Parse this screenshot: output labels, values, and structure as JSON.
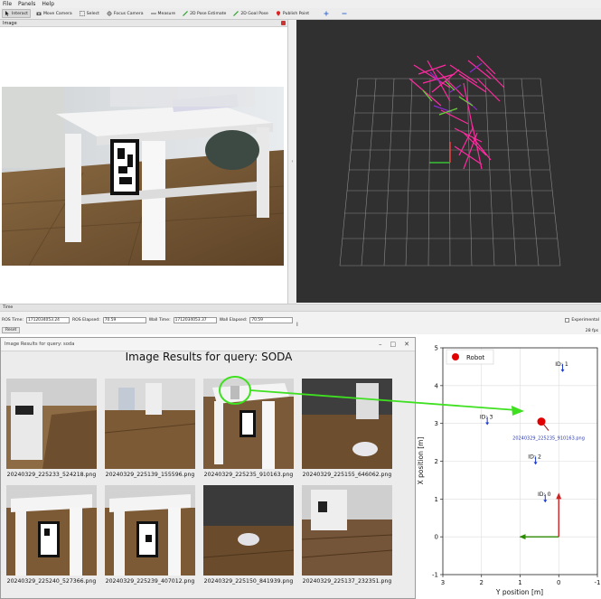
{
  "menu": [
    "File",
    "Panels",
    "Help"
  ],
  "toolbar": {
    "tools": [
      {
        "label": "Interact",
        "icon": "interact-icon",
        "active": true
      },
      {
        "label": "Move Camera",
        "icon": "move-camera-icon",
        "active": false
      },
      {
        "label": "Select",
        "icon": "select-icon",
        "active": false
      },
      {
        "label": "Focus Camera",
        "icon": "focus-camera-icon",
        "active": false
      },
      {
        "label": "Measure",
        "icon": "measure-icon",
        "active": false
      },
      {
        "label": "2D Pose Estimate",
        "icon": "pose-estimate-icon",
        "active": false
      },
      {
        "label": "2D Goal Pose",
        "icon": "goal-pose-icon",
        "active": false
      },
      {
        "label": "Publish Point",
        "icon": "publish-point-icon",
        "active": false
      }
    ],
    "extra_icons": [
      "add-tool-icon",
      "remove-tool-icon"
    ]
  },
  "image_panel": {
    "title": "Image"
  },
  "time_panel": {
    "title": "Time",
    "ros_time_label": "ROS Time:",
    "ros_time": "1712034053.24",
    "ros_elapsed_label": "ROS Elapsed:",
    "ros_elapsed": "70.59",
    "wall_time_label": "Wall Time:",
    "wall_time": "1712034053.37",
    "wall_elapsed_label": "Wall Elapsed:",
    "wall_elapsed": "70.59",
    "experimental_label": "Experimental",
    "fps": "28 fps",
    "reset_label": "Reset"
  },
  "results_window": {
    "title": "Image Results for query: soda",
    "heading": "Image Results for query: SODA",
    "images": [
      {
        "caption": "20240329_225233_524218.png"
      },
      {
        "caption": "20240329_225139_155596.png"
      },
      {
        "caption": "20240329_225235_910163.png"
      },
      {
        "caption": "20240329_225155_646062.png"
      },
      {
        "caption": "20240329_225240_527366.png"
      },
      {
        "caption": "20240329_225239_407012.png"
      },
      {
        "caption": "20240329_225150_841939.png"
      },
      {
        "caption": "20240329_225137_232351.png"
      }
    ]
  },
  "chart_data": {
    "type": "scatter",
    "xlabel": "Y position [m]",
    "ylabel": "X position [m]",
    "xlim": [
      3,
      -1
    ],
    "ylim": [
      -1,
      5
    ],
    "xticks": [
      "3",
      "2",
      "1",
      "0",
      "-1"
    ],
    "yticks": [
      "-1",
      "0",
      "1",
      "2",
      "3",
      "4",
      "5"
    ],
    "grid": true,
    "legend": {
      "entries": [
        "Robot"
      ],
      "placement": "top-left"
    },
    "robot": {
      "y": 0.45,
      "x": 3.05,
      "color": "#e00000",
      "label": "20240329_225235_910163.png"
    },
    "markers": [
      {
        "label": "ID: 1",
        "y": -0.1,
        "x": 4.5
      },
      {
        "label": "ID: 3",
        "y": 1.85,
        "x": 3.1
      },
      {
        "label": "ID: 2",
        "y": 0.6,
        "x": 2.05
      },
      {
        "label": "ID: 0",
        "y": 0.35,
        "x": 1.05
      }
    ],
    "origin_axes": {
      "y_axis_color": "#2a8a00",
      "x_axis_color": "#cc2222"
    }
  }
}
